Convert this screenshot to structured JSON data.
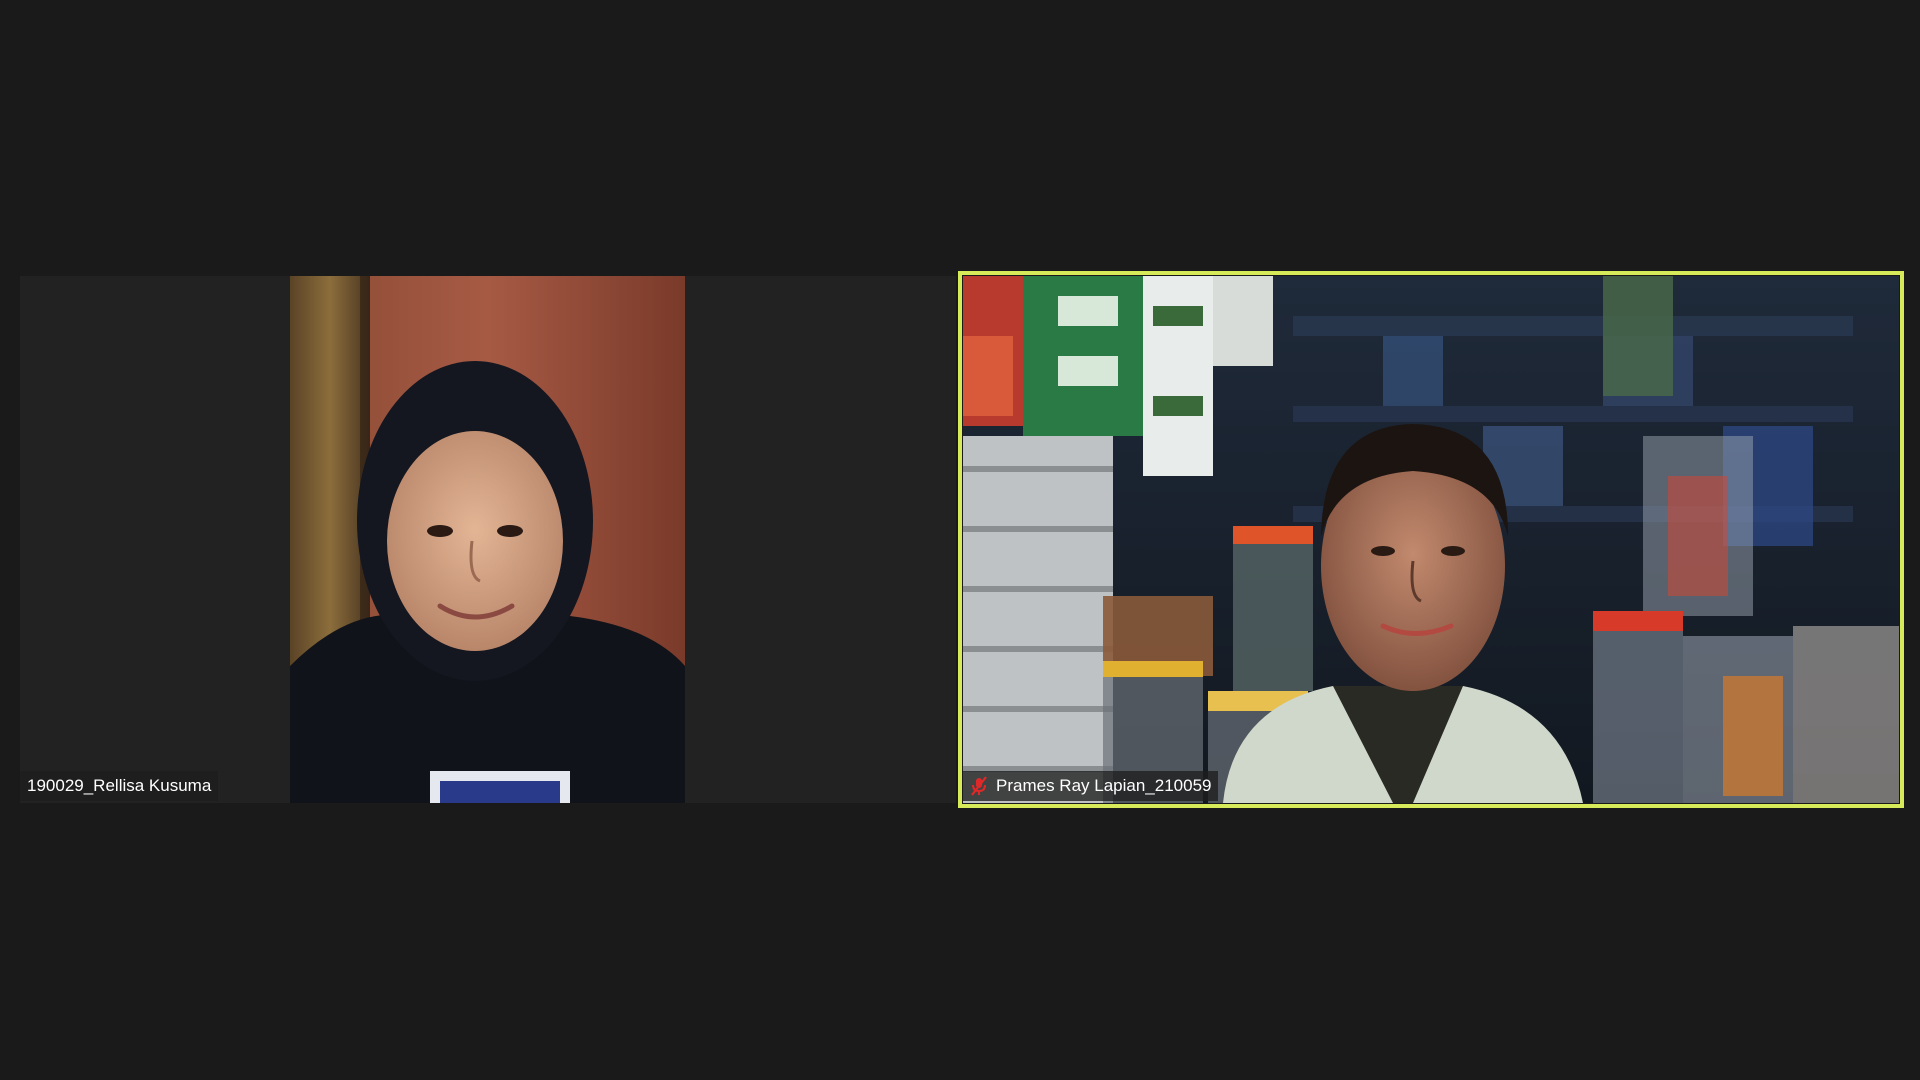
{
  "meeting": {
    "accent_active_speaker": "#d6ea5a",
    "background": "#1a1a1a",
    "participants": [
      {
        "name": "190029_Rellisa Kusuma",
        "muted": false,
        "active_speaker": false
      },
      {
        "name": "Prames Ray Lapian_210059",
        "muted": true,
        "mute_icon": "mic-muted-icon",
        "mute_icon_color": "#e02828",
        "active_speaker": true
      }
    ]
  }
}
